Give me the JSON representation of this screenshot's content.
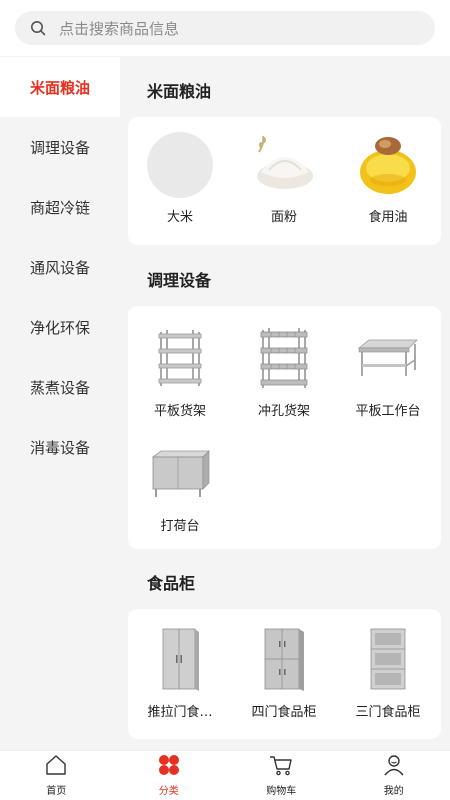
{
  "search": {
    "placeholder": "点击搜索商品信息",
    "icon": "search-icon"
  },
  "sidebar": {
    "items": [
      {
        "label": "米面粮油",
        "active": true
      },
      {
        "label": "调理设备"
      },
      {
        "label": "商超冷链"
      },
      {
        "label": "通风设备"
      },
      {
        "label": "净化环保"
      },
      {
        "label": "蒸煮设备"
      },
      {
        "label": "消毒设备"
      }
    ]
  },
  "sections": [
    {
      "title": "米面粮油",
      "items": [
        {
          "label": "大米"
        },
        {
          "label": "面粉"
        },
        {
          "label": "食用油"
        }
      ]
    },
    {
      "title": "调理设备",
      "items": [
        {
          "label": "平板货架"
        },
        {
          "label": "冲孔货架"
        },
        {
          "label": "平板工作台"
        },
        {
          "label": "打荷台"
        }
      ]
    },
    {
      "title": "食品柜",
      "items": [
        {
          "label": "推拉门食…"
        },
        {
          "label": "四门食品柜"
        },
        {
          "label": "三门食品柜"
        }
      ]
    }
  ],
  "tabbar": {
    "items": [
      {
        "label": "首页",
        "icon": "home-icon"
      },
      {
        "label": "分类",
        "icon": "category-icon",
        "active": true
      },
      {
        "label": "购物车",
        "icon": "cart-icon"
      },
      {
        "label": "我的",
        "icon": "profile-icon"
      }
    ]
  },
  "colors": {
    "accent": "#e63020",
    "background": "#f4f4f4",
    "card": "#ffffff"
  }
}
